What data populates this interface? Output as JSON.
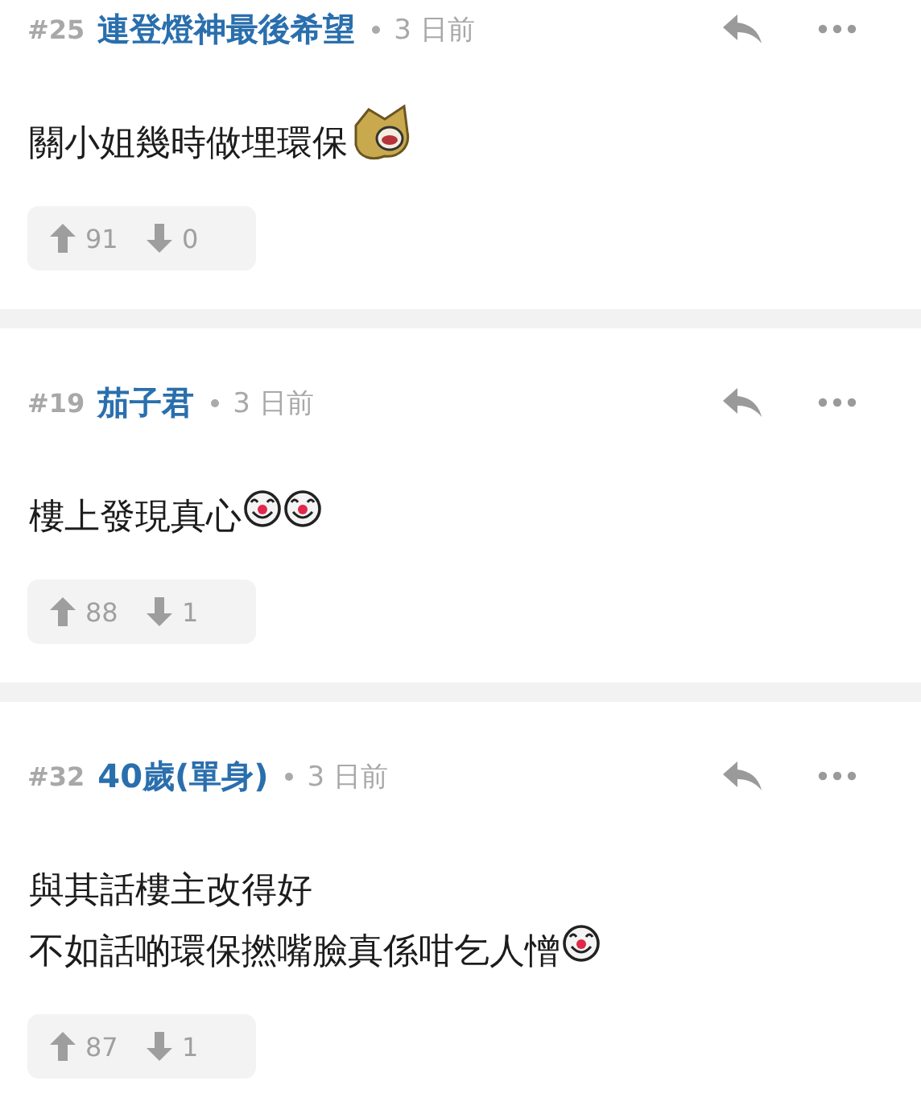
{
  "posts": [
    {
      "floor": "#25",
      "author": "連登燈神最後希望",
      "time": "3 日前",
      "body": [
        [
          {
            "kind": "text",
            "text": "關小姐幾時做埋環保"
          },
          {
            "kind": "dog"
          }
        ]
      ],
      "upvotes": "91",
      "downvotes": "0"
    },
    {
      "floor": "#19",
      "author": "茄子君",
      "time": "3 日前",
      "body": [
        [
          {
            "kind": "text",
            "text": "樓上發現真心"
          },
          {
            "kind": "clown"
          },
          {
            "kind": "clown"
          }
        ]
      ],
      "upvotes": "88",
      "downvotes": "1"
    },
    {
      "floor": "#32",
      "author": "40歲(單身)",
      "time": "3 日前",
      "body": [
        [
          {
            "kind": "text",
            "text": "與其話樓主改得好"
          }
        ],
        [
          {
            "kind": "text",
            "text": "不如話啲環保撚嘴臉真係咁乞人憎"
          },
          {
            "kind": "clown"
          }
        ]
      ],
      "upvotes": "87",
      "downvotes": "1"
    }
  ]
}
